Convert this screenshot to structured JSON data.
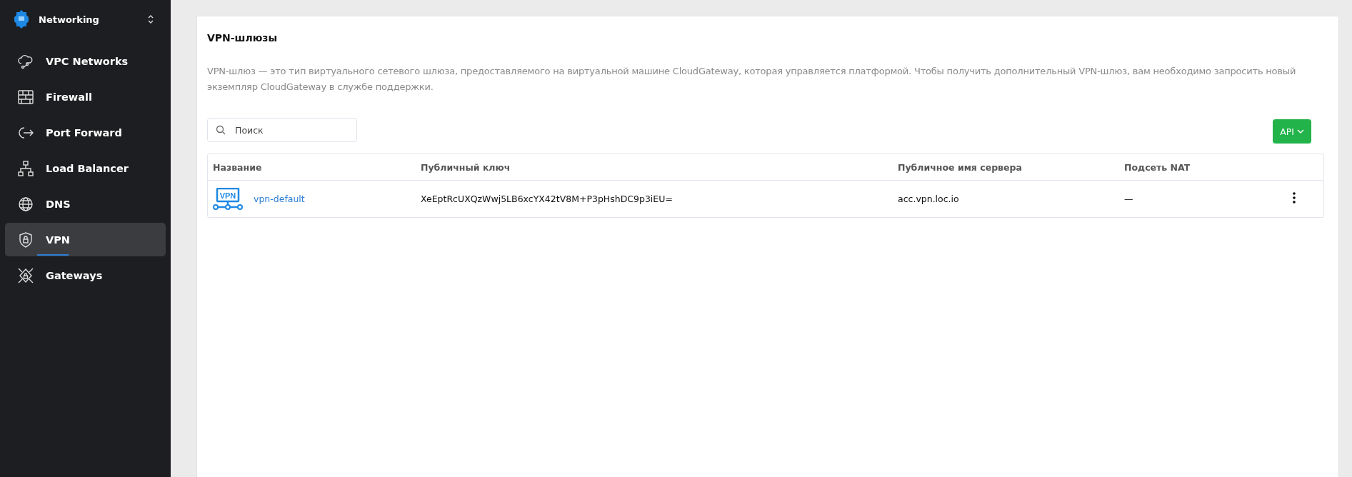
{
  "sidebar": {
    "title": "Networking",
    "items": [
      {
        "label": "VPC Networks",
        "kind": "cloud",
        "selected": false
      },
      {
        "label": "Firewall",
        "kind": "wall",
        "selected": false
      },
      {
        "label": "Port Forward",
        "kind": "forward",
        "selected": false
      },
      {
        "label": "Load Balancer",
        "kind": "tree",
        "selected": false
      },
      {
        "label": "DNS",
        "kind": "globe",
        "selected": false
      },
      {
        "label": "VPN",
        "kind": "shield",
        "selected": true
      },
      {
        "label": "Gateways",
        "kind": "gateway",
        "selected": false
      }
    ]
  },
  "page": {
    "title": "VPN-шлюзы",
    "description": "VPN-шлюз — это тип виртуального сетевого шлюза, предоставляемого на виртуальной машине CloudGateway, которая управляется платформой. Чтобы получить дополнительный VPN-шлюз, вам необходимо запросить новый экземпляр CloudGateway в службе поддержки.",
    "search": {
      "placeholder": "Поиск"
    },
    "api_button": "API"
  },
  "table": {
    "columns": [
      "Название",
      "Публичный ключ",
      "Публичное имя сервера",
      "Подсеть NAT"
    ],
    "rows": [
      {
        "name": "vpn-default",
        "icon_label": "VPN",
        "public_key": "XeEptRcUXQzWwj5LB6xcYX42tV8M+P3pHshDC9p3iEU=",
        "server": "acc.vpn.loc.io",
        "nat": "—"
      }
    ]
  }
}
